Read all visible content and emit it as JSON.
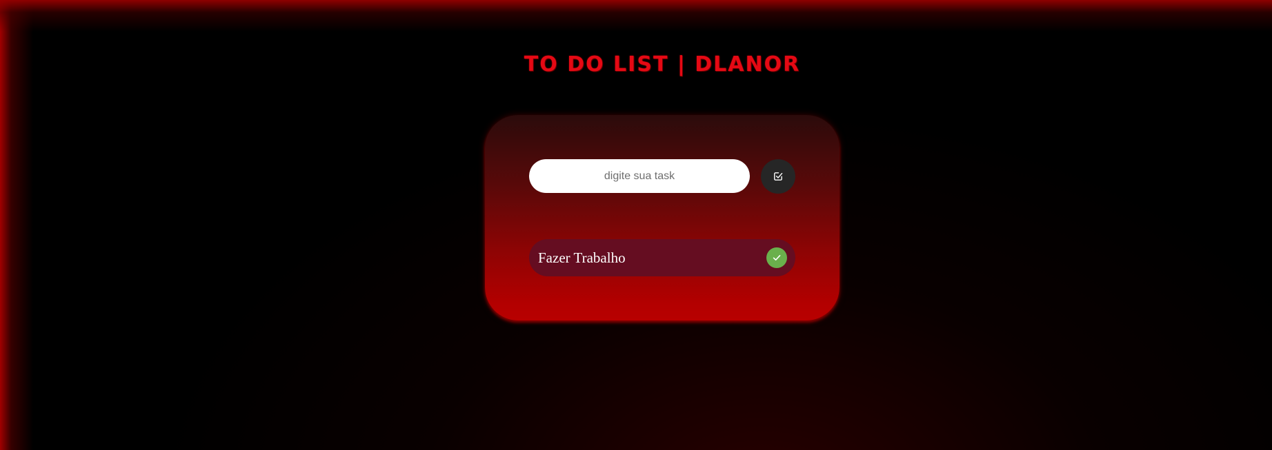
{
  "app": {
    "title": "TO DO LIST | DLANOR"
  },
  "colors": {
    "accent": "#e50914",
    "card_top": "#2b0b0b",
    "card_bottom": "#b80000",
    "task_item_bg": "#650d21",
    "add_button_bg": "#262626",
    "done_button_bg": "#6ab04c"
  },
  "input": {
    "placeholder": "digite sua task",
    "value": ""
  },
  "add_button": {
    "icon": "checkbox-check-icon"
  },
  "tasks": [
    {
      "label": "Fazer Trabalho",
      "icon": "check-icon"
    }
  ]
}
